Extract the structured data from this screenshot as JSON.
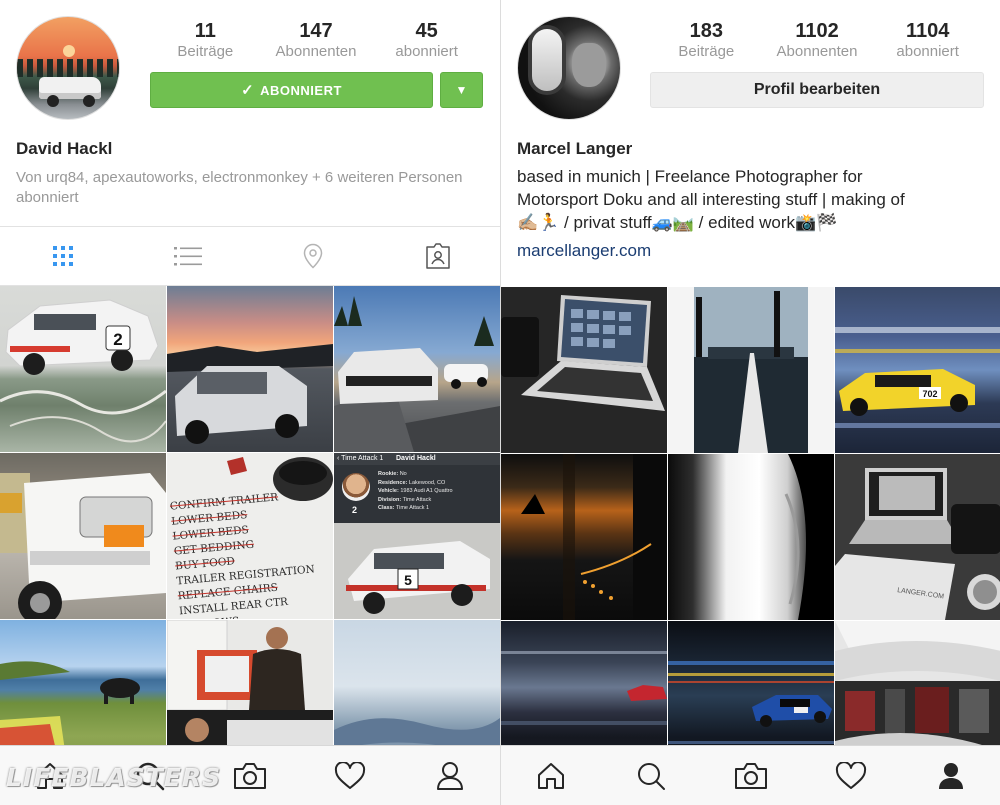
{
  "left_profile": {
    "name": "David Hackl",
    "stats": [
      {
        "value": "11",
        "label": "Beiträge"
      },
      {
        "value": "147",
        "label": "Abonnenten"
      },
      {
        "value": "45",
        "label": "abonniert"
      }
    ],
    "follow_button_label": "ABONNIERT",
    "followed_by_text": "Von urq84, apexautoworks, electronmonkey + 6 weiteren Personen abonniert",
    "tabs": [
      {
        "icon": "grid-icon",
        "active": true
      },
      {
        "icon": "list-icon",
        "active": false
      },
      {
        "icon": "location-pin-icon",
        "active": false
      },
      {
        "icon": "tagged-icon",
        "active": false
      }
    ],
    "post_overlay": {
      "header_back": "Time Attack 1",
      "header_name": "David Hackl",
      "car_number": "2",
      "big_number": "5",
      "details": [
        {
          "key": "Rookie:",
          "value": "No"
        },
        {
          "key": "Residence:",
          "value": "Lakewood, CO"
        },
        {
          "key": "Vehicle:",
          "value": "1983 Audi A1 Quattro"
        },
        {
          "key": "Division:",
          "value": "Time Attack"
        },
        {
          "key": "Class:",
          "value": "Time Attack 1"
        }
      ]
    },
    "note_lines": [
      "CONFIRM TRAILER",
      "LOWER BEDS",
      "LOWER BEDS",
      "GET BEDDING",
      "BUY FOOD",
      "TRAILER REGISTRATION",
      "REPLACE CHAIRS",
      "INSTALL REAR CTR WINDOWS"
    ],
    "watermark": "LIFEBLASTERS"
  },
  "right_profile": {
    "name": "Marcel Langer",
    "stats": [
      {
        "value": "183",
        "label": "Beiträge"
      },
      {
        "value": "1102",
        "label": "Abonnenten"
      },
      {
        "value": "1104",
        "label": "abonniert"
      }
    ],
    "edit_button_label": "Profil bearbeiten",
    "bio_lines": [
      "based in munich | Freelance Photographer for",
      "Motorsport Doku and all interesting stuff | making of",
      "✍🏼🏃 / privat stuff🚙🛤️ / edited work📸🏁"
    ],
    "website": "marcellanger.com",
    "car_number": "702",
    "paper_text": "LANGER.COM"
  },
  "bottom_nav": {
    "items": [
      {
        "icon": "home-icon"
      },
      {
        "icon": "search-icon"
      },
      {
        "icon": "camera-icon"
      },
      {
        "icon": "heart-icon"
      },
      {
        "icon": "profile-icon"
      }
    ]
  },
  "colors": {
    "follow_green": "#70c050",
    "link_blue": "#1b3d72",
    "secondary_text": "#999999",
    "active_tab": "#3897f0"
  }
}
